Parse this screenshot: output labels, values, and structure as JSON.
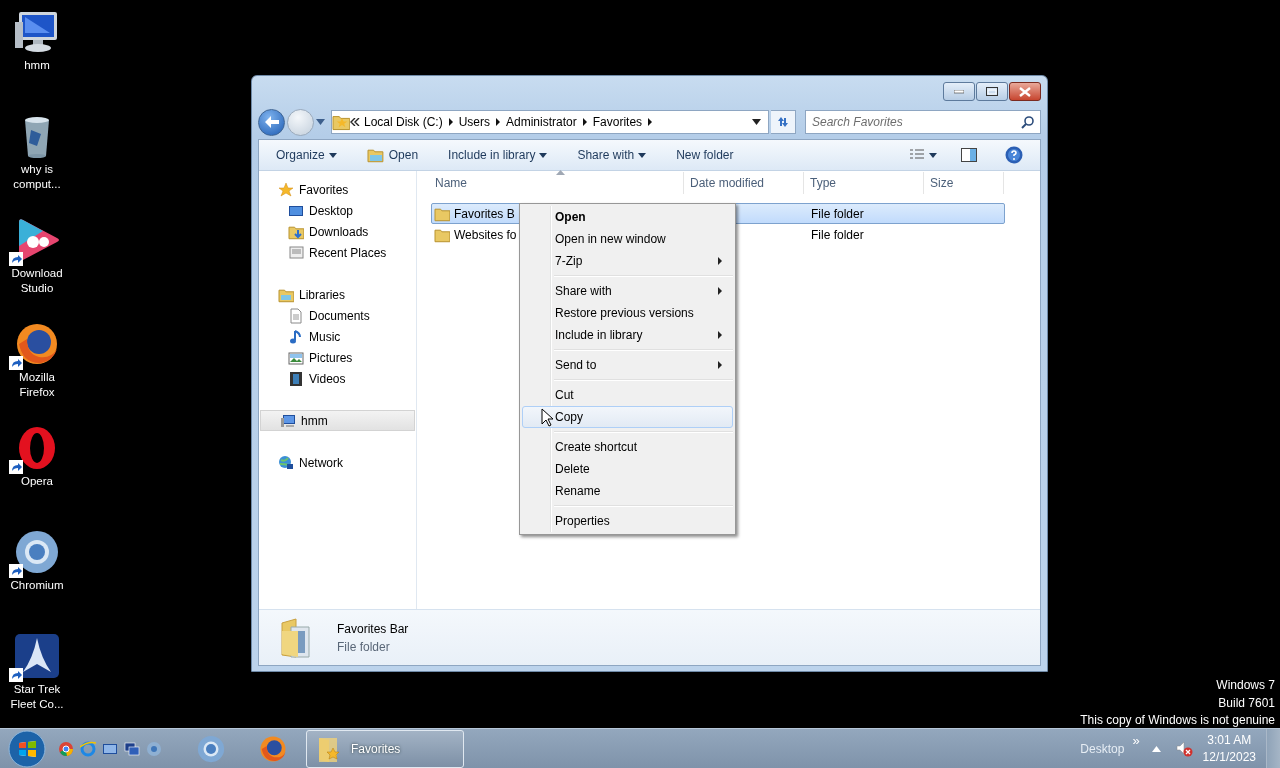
{
  "desktop_icons": [
    {
      "label": "hmm",
      "kind": "computer",
      "shortcut": false
    },
    {
      "label": "why is comput...",
      "kind": "recycle",
      "shortcut": false
    },
    {
      "label": "Download Studio",
      "kind": "studio",
      "shortcut": true
    },
    {
      "label": "Mozilla Firefox",
      "kind": "firefox",
      "shortcut": true
    },
    {
      "label": "Opera",
      "kind": "opera",
      "shortcut": true
    },
    {
      "label": "Chromium",
      "kind": "chromium",
      "shortcut": true
    },
    {
      "label": "Star Trek Fleet Co...",
      "kind": "startrek",
      "shortcut": true
    }
  ],
  "window": {
    "address": {
      "breadcrumbs": [
        "Local Disk (C:)",
        "Users",
        "Administrator",
        "Favorites"
      ]
    },
    "search": {
      "placeholder": "Search Favorites"
    },
    "toolbar": [
      {
        "label": "Organize",
        "kind": "menu"
      },
      {
        "label": "Open",
        "kind": "icon"
      },
      {
        "label": "Include in library",
        "kind": "menu"
      },
      {
        "label": "Share with",
        "kind": "menu"
      },
      {
        "label": "New folder",
        "kind": "plain"
      }
    ],
    "nav": [
      {
        "label": "Favorites",
        "kind": "star",
        "selected": false,
        "children": [
          {
            "label": "Desktop",
            "kind": "desktop",
            "selected": false
          },
          {
            "label": "Downloads",
            "kind": "downloads",
            "selected": false
          },
          {
            "label": "Recent Places",
            "kind": "recent",
            "selected": false
          }
        ]
      },
      {
        "label": "Libraries",
        "kind": "libraries",
        "selected": false,
        "children": [
          {
            "label": "Documents",
            "kind": "documents",
            "selected": false
          },
          {
            "label": "Music",
            "kind": "music",
            "selected": false
          },
          {
            "label": "Pictures",
            "kind": "pictures",
            "selected": false
          },
          {
            "label": "Videos",
            "kind": "videos",
            "selected": false
          }
        ]
      },
      {
        "label": "hmm",
        "kind": "computer",
        "selected": true
      },
      {
        "label": "Network",
        "kind": "network",
        "selected": false
      }
    ],
    "columns": [
      {
        "label": "Name",
        "sorted": true
      },
      {
        "label": "Date modified",
        "sorted": false
      },
      {
        "label": "Type",
        "sorted": false
      },
      {
        "label": "Size",
        "sorted": false
      }
    ],
    "rows": [
      {
        "name": "Favorites B",
        "type": "File folder",
        "selected": true
      },
      {
        "name": "Websites fo",
        "type": "File folder",
        "selected": false
      }
    ],
    "details": {
      "name": "Favorites Bar",
      "type": "File folder"
    }
  },
  "context_menu": [
    {
      "kind": "item",
      "label": "Open",
      "bold": true,
      "submenu": false,
      "selected": false
    },
    {
      "kind": "item",
      "label": "Open in new window",
      "bold": false,
      "submenu": false,
      "selected": false
    },
    {
      "kind": "item",
      "label": "7-Zip",
      "bold": false,
      "submenu": true,
      "selected": false
    },
    {
      "kind": "separator"
    },
    {
      "kind": "item",
      "label": "Share with",
      "bold": false,
      "submenu": true,
      "selected": false
    },
    {
      "kind": "item",
      "label": "Restore previous versions",
      "bold": false,
      "submenu": false,
      "selected": false
    },
    {
      "kind": "item",
      "label": "Include in library",
      "bold": false,
      "submenu": true,
      "selected": false
    },
    {
      "kind": "separator"
    },
    {
      "kind": "item",
      "label": "Send to",
      "bold": false,
      "submenu": true,
      "selected": false
    },
    {
      "kind": "separator"
    },
    {
      "kind": "item",
      "label": "Cut",
      "bold": false,
      "submenu": false,
      "selected": false
    },
    {
      "kind": "item",
      "label": "Copy",
      "bold": false,
      "submenu": false,
      "selected": true
    },
    {
      "kind": "separator"
    },
    {
      "kind": "item",
      "label": "Create shortcut",
      "bold": false,
      "submenu": false,
      "selected": false
    },
    {
      "kind": "item",
      "label": "Delete",
      "bold": false,
      "submenu": false,
      "selected": false
    },
    {
      "kind": "item",
      "label": "Rename",
      "bold": false,
      "submenu": false,
      "selected": false
    },
    {
      "kind": "separator"
    },
    {
      "kind": "item",
      "label": "Properties",
      "bold": false,
      "submenu": false,
      "selected": false
    }
  ],
  "genuine_notice": [
    "Windows 7",
    "Build 7601",
    "This copy of Windows is not genuine"
  ],
  "taskbar": {
    "quick_launch": [
      {
        "kind": "chrome"
      },
      {
        "kind": "ie"
      },
      {
        "kind": "desktop"
      },
      {
        "kind": "switch"
      },
      {
        "kind": "chromium"
      }
    ],
    "pinned": [
      {
        "kind": "chromium"
      },
      {
        "kind": "firefox"
      }
    ],
    "windows": [
      {
        "label": "Favorites",
        "selected": true
      }
    ],
    "toolbar_label": "Desktop",
    "overflow": "»",
    "time": "3:01 AM",
    "date": "12/1/2023"
  }
}
